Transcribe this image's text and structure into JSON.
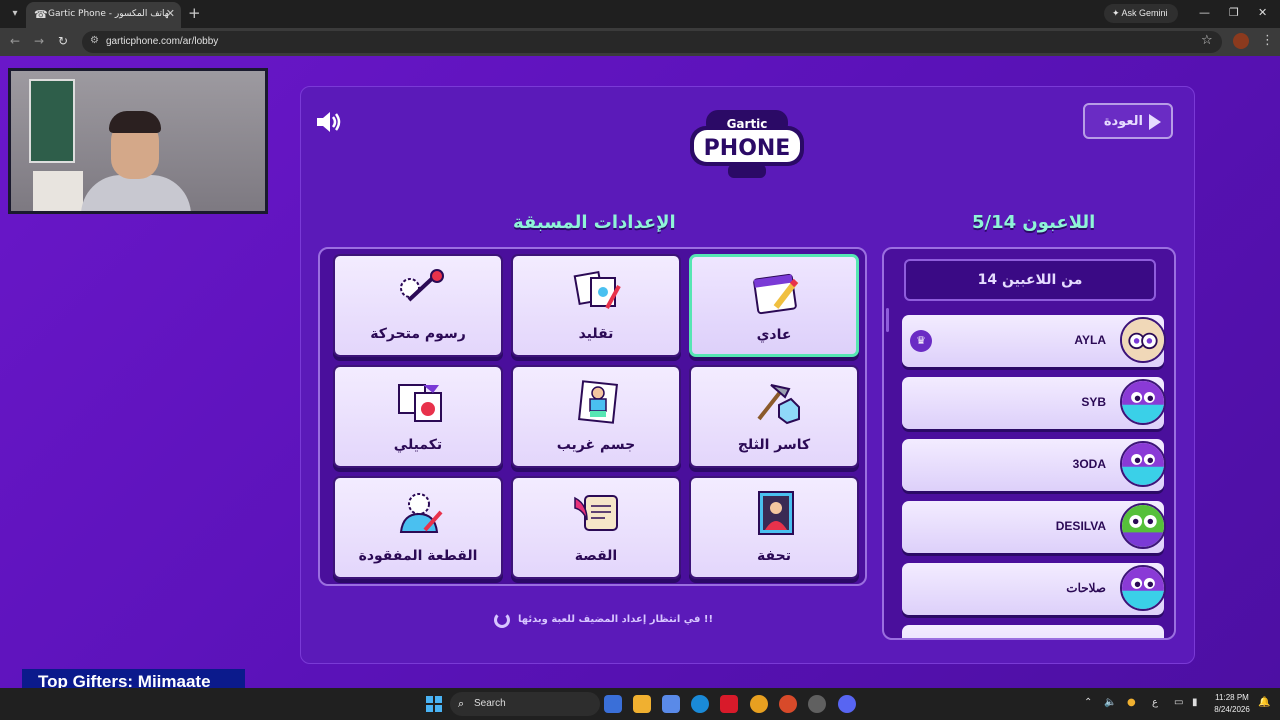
{
  "browser": {
    "tab_title": "Gartic Phone - الهاتف المكسور",
    "url": "garticphone.com/ar/lobby",
    "gemini_label": "Ask Gemini"
  },
  "game": {
    "back_label": "العودة",
    "logo_top": "Gartic",
    "logo_main": "PHONE",
    "presets_title": "الإعدادات المسبقة",
    "players_title": "اللاعبون 5/14",
    "players_count_label": "14 من اللاعبين",
    "presets": [
      {
        "label": "رسوم متحركة",
        "icon": "animation-icon",
        "selected": false
      },
      {
        "label": "تقليد",
        "icon": "imitation-icon",
        "selected": false
      },
      {
        "label": "عادي",
        "icon": "normal-icon",
        "selected": true
      },
      {
        "label": "تكميلي",
        "icon": "complement-icon",
        "selected": false
      },
      {
        "label": "جسم غريب",
        "icon": "strange-body-icon",
        "selected": false
      },
      {
        "label": "كاسر الثلج",
        "icon": "icebreaker-icon",
        "selected": false
      },
      {
        "label": "القطعة المفقودة",
        "icon": "missing-piece-icon",
        "selected": false
      },
      {
        "label": "القصة",
        "icon": "story-icon",
        "selected": false
      },
      {
        "label": "تحفة",
        "icon": "masterpiece-icon",
        "selected": false
      }
    ],
    "players": [
      {
        "name": "AYLA",
        "host": true
      },
      {
        "name": "SYB",
        "host": false
      },
      {
        "name": "3ODA",
        "host": false
      },
      {
        "name": "DESILVA",
        "host": false
      },
      {
        "name": "صلاحات",
        "host": false
      }
    ],
    "waiting_text": "في انتظار إعداد المضيف للعبة وبدئها !!"
  },
  "overlay": {
    "gifters": "Top Gifters: Miimaate"
  },
  "taskbar": {
    "search_placeholder": "Search",
    "time": "11:28 PM",
    "date": "8/24/2026",
    "lang": "ع"
  },
  "colors": {
    "accent": "#8ff4d8",
    "background": "#5a12b8",
    "selected_border": "#56e6b3"
  }
}
